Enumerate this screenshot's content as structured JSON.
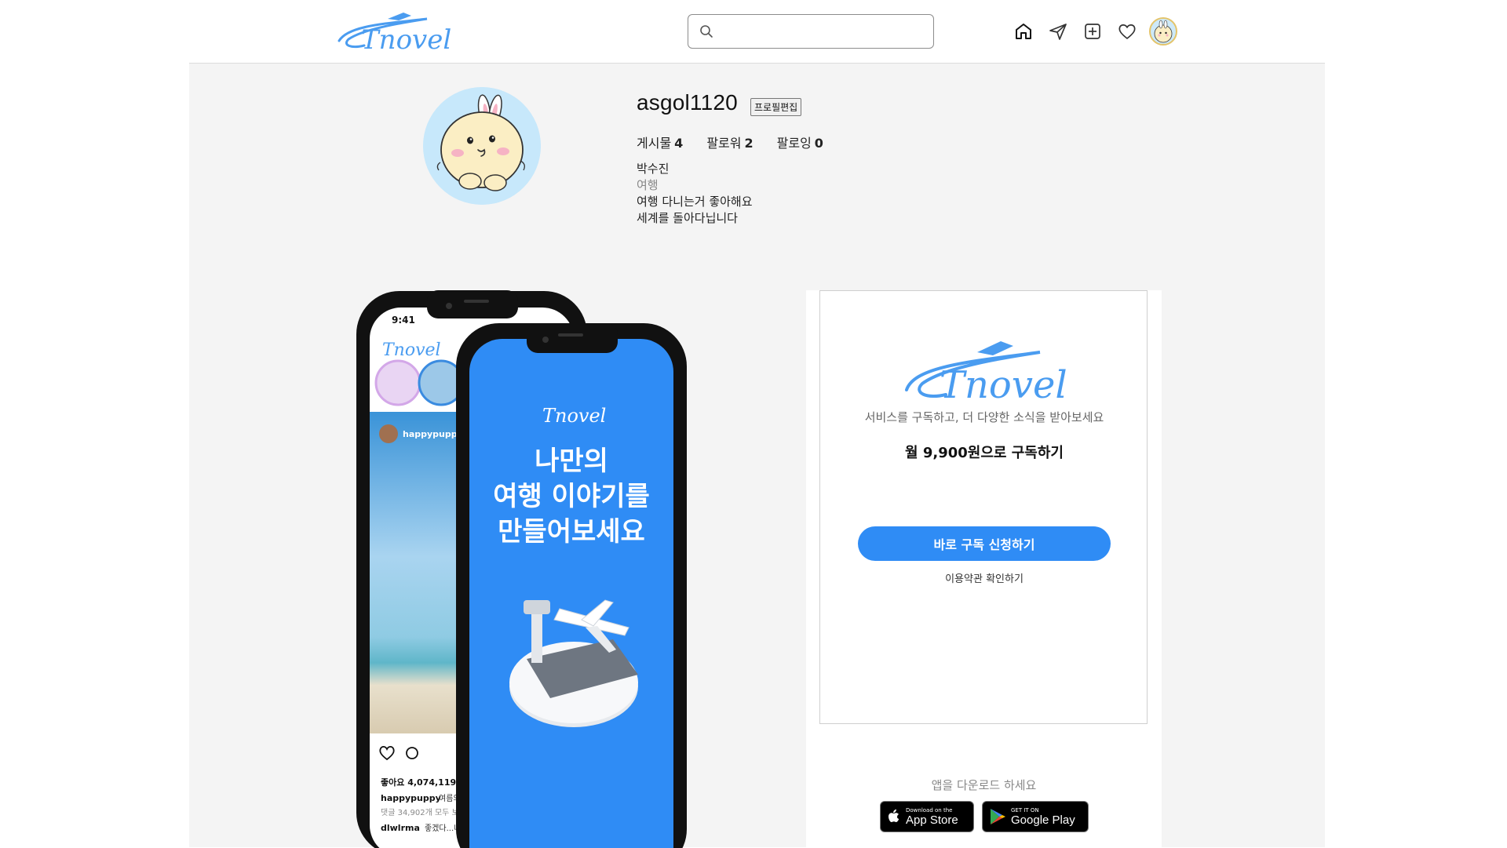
{
  "header": {
    "logo_text": "Tnovel",
    "search_placeholder": "",
    "nav": [
      "home-icon",
      "send-icon",
      "add-post-icon",
      "heart-icon",
      "profile-avatar"
    ]
  },
  "profile": {
    "username": "asgol1120",
    "edit_label": "프로필편집",
    "stats": [
      {
        "label": "게시물",
        "value": "4"
      },
      {
        "label": "팔로워",
        "value": "2"
      },
      {
        "label": "팔로잉",
        "value": "0"
      }
    ],
    "name": "박수진",
    "category": "여행",
    "bio_lines": [
      "여행 다니는거 좋아해요",
      "세계를 돌아다닙니다"
    ]
  },
  "phone_back": {
    "time": "9:41",
    "logo_text": "Tnovel",
    "post_user": "happypuppy",
    "likes": "좋아요 4,074,119개",
    "caption_user": "happypuppy",
    "caption_text": "여름의 토론",
    "comments": "댓글 34,902개 모두 보기",
    "comment_user": "dlwlrma",
    "comment_text": "좋겠다...나도 여"
  },
  "phone_front": {
    "logo_text": "Tnovel",
    "headline": [
      "나만의",
      "여행 이야기를",
      "만들어보세요"
    ]
  },
  "subscribe": {
    "logo_text": "Tnovel",
    "description": "서비스를 구독하고, 더 다양한 소식을 받아보세요",
    "price": "월 9,900원으로 구독하기",
    "button_label": "바로 구독 신청하기",
    "terms_label": "이용약관 확인하기",
    "download_text": "앱을 다운로드 하세요",
    "app_store_small": "Download on the",
    "app_store_big": "App Store",
    "google_small": "GET IT ON",
    "google_big": "Google Play"
  },
  "colors": {
    "brand_blue": "#2f8cf5",
    "logo_blue": "#4a9cf0",
    "page_gray": "#f4f4f4"
  }
}
